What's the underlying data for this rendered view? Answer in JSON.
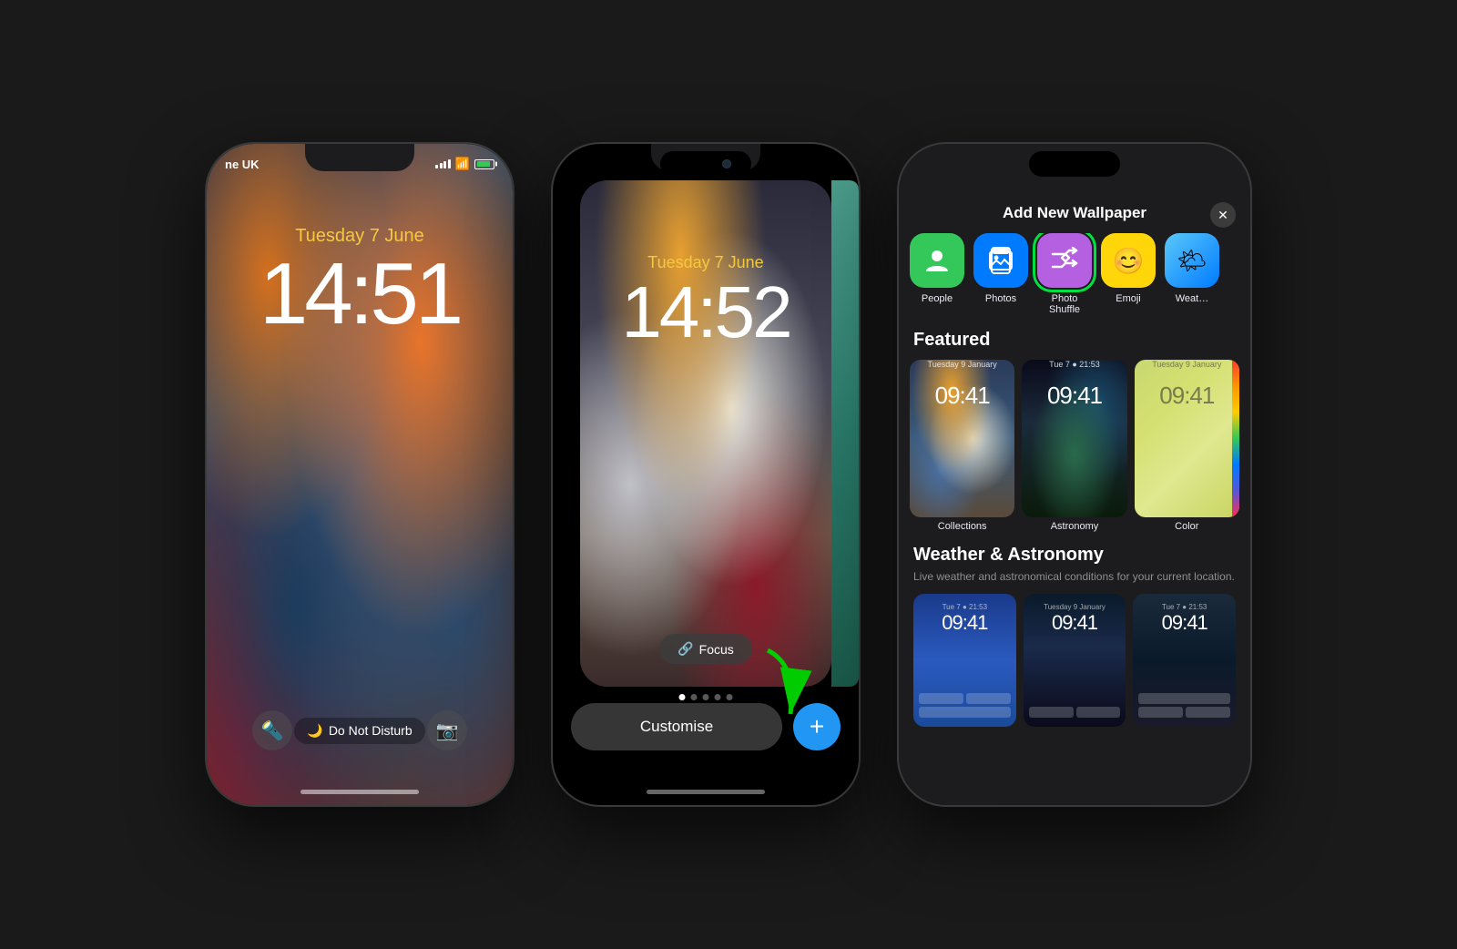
{
  "phone1": {
    "carrier": "ne UK",
    "date": "Tuesday 7 June",
    "time": "14:51",
    "dnd_label": "Do Not Disturb",
    "home_indicator": true
  },
  "phone2": {
    "date": "Tuesday 7 June",
    "time": "14:52",
    "focus_label": "Focus",
    "customise_label": "Customise",
    "plus_label": "+",
    "dots_count": 5,
    "active_dot": 0
  },
  "phone3": {
    "header_title": "Add New Wallpaper",
    "close_label": "×",
    "categories": [
      {
        "id": "people",
        "label": "People",
        "icon": "👤",
        "bg": "people"
      },
      {
        "id": "photos",
        "label": "Photos",
        "icon": "🖼",
        "bg": "photos"
      },
      {
        "id": "photo_shuffle",
        "label": "Photo\nShuffle",
        "icon": "⇄",
        "bg": "photo-shuffle",
        "highlighted": true
      },
      {
        "id": "emoji",
        "label": "Emoji",
        "icon": "😊",
        "bg": "emoji"
      },
      {
        "id": "weather",
        "label": "Weat…",
        "icon": "🌤",
        "bg": "weather"
      }
    ],
    "featured_title": "Featured",
    "featured_items": [
      {
        "label": "Collections",
        "time": "09:41",
        "date": "Tuesday 9 January",
        "bg": "wp-preview-bg1"
      },
      {
        "label": "Astronomy",
        "time": "09:41",
        "date": "Tue 7 ● 21:53",
        "bg": "wp-preview-bg2"
      },
      {
        "label": "Color",
        "time": "09:41",
        "date": "Tuesday 9 January",
        "bg": "wp-preview-bg3"
      }
    ],
    "weather_section_title": "Weather & Astronomy",
    "weather_section_desc": "Live weather and astronomical conditions for your current location.",
    "weather_items": [
      {
        "time": "09:41",
        "date": "Tue 7 ● 21:53",
        "bg": "wp-weather-bg1"
      },
      {
        "time": "09:41",
        "date": "Tuesday 9 January",
        "bg": "wp-weather-bg2"
      },
      {
        "time": "09:41",
        "date": "Tue 7 ● 21:53",
        "bg": "wp-weather-bg3"
      }
    ]
  }
}
